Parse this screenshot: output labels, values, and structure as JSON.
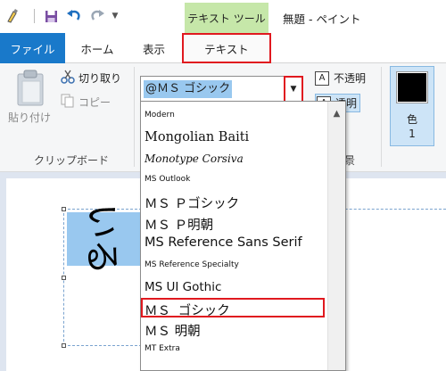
{
  "titlebar": {
    "qat_icons": [
      "paint-app-icon",
      "save-icon",
      "undo-icon",
      "redo-icon",
      "customize-arrow-icon"
    ],
    "context_tab_label": "テキスト ツール",
    "window_title": "無題 - ペイント"
  },
  "tabs": {
    "file": "ファイル",
    "home": "ホーム",
    "view": "表示",
    "text": "テキスト"
  },
  "clipboard": {
    "paste": "貼り付け",
    "cut": "切り取り",
    "copy": "コピー",
    "group_label": "クリップボード"
  },
  "font": {
    "current": "@ＭＳ ゴシック"
  },
  "background": {
    "opaque": "不透明",
    "transparent": "透明",
    "group_label_partial": "景"
  },
  "color": {
    "label": "色",
    "number": "1",
    "value": "#000000"
  },
  "canvas": {
    "text": "いる"
  },
  "font_list": [
    {
      "name": "Modern",
      "style": "small"
    },
    {
      "name": "Mongolian Baiti",
      "style": "big"
    },
    {
      "name": "Monotype Corsiva",
      "style": "italic"
    },
    {
      "name": "MS Outlook",
      "style": "small"
    },
    {
      "name": "ＭＳ Ｐゴシック",
      "style": "big"
    },
    {
      "name": "ＭＳ Ｐ明朝",
      "style": "big"
    },
    {
      "name": "MS Reference Sans Serif",
      "style": "big"
    },
    {
      "name": "MS Reference Specialty",
      "style": "small"
    },
    {
      "name": "MS UI Gothic",
      "style": "big"
    },
    {
      "name": "ＭＳ ゴシック",
      "style": "big"
    },
    {
      "name": "ＭＳ 明朝",
      "style": "big"
    },
    {
      "name": "MT Extra",
      "style": "small"
    }
  ],
  "colors": {
    "file_tab": "#1979ca",
    "context_tab": "#c6e7a9",
    "highlight": "#e0191f",
    "selection": "#99c8ef"
  }
}
